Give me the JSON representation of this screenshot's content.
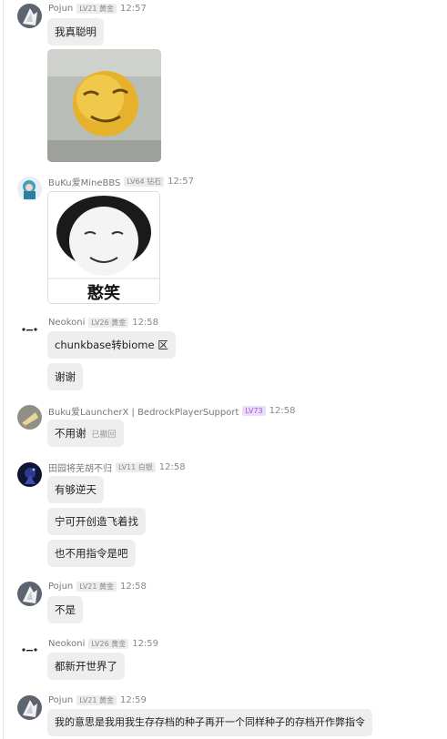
{
  "messages": [
    {
      "user": "Pojun",
      "badge": "LV21 黄金",
      "time": "12:57",
      "bubbles": [
        "我真聪明"
      ]
    },
    {
      "user": "BuKu爱MineBBS",
      "badge": "LV64 钻石",
      "time": "12:57",
      "image_caption": "憨笑"
    },
    {
      "user": "Neokoni",
      "badge": "LV26 黄金",
      "time": "12:58",
      "bubbles": [
        "chunkbase转biome 区",
        "谢谢"
      ]
    },
    {
      "user": "Buku爱LauncherX | BedrockPlayerSupport",
      "badge": "LV73",
      "time": "12:58",
      "bubbles": [
        "不用谢"
      ],
      "recalled": "已撤回"
    },
    {
      "user": "田园将芜胡不归",
      "badge": "LV11 白银",
      "time": "12:58",
      "bubbles": [
        "有够逆天",
        "宁可开创造飞着找",
        "也不用指令是吧"
      ]
    },
    {
      "user": "Pojun",
      "badge": "LV21 黄金",
      "time": "12:58",
      "bubbles": [
        "不是"
      ]
    },
    {
      "user": "Neokoni",
      "badge": "LV26 黄金",
      "time": "12:59",
      "bubbles": [
        "都新开世界了"
      ]
    },
    {
      "user": "Pojun",
      "badge": "LV21 黄金",
      "time": "12:59",
      "bubbles": [
        "我的意思是我用我生存存档的种子再开一个同样种子的存档开作弊指令"
      ]
    }
  ]
}
